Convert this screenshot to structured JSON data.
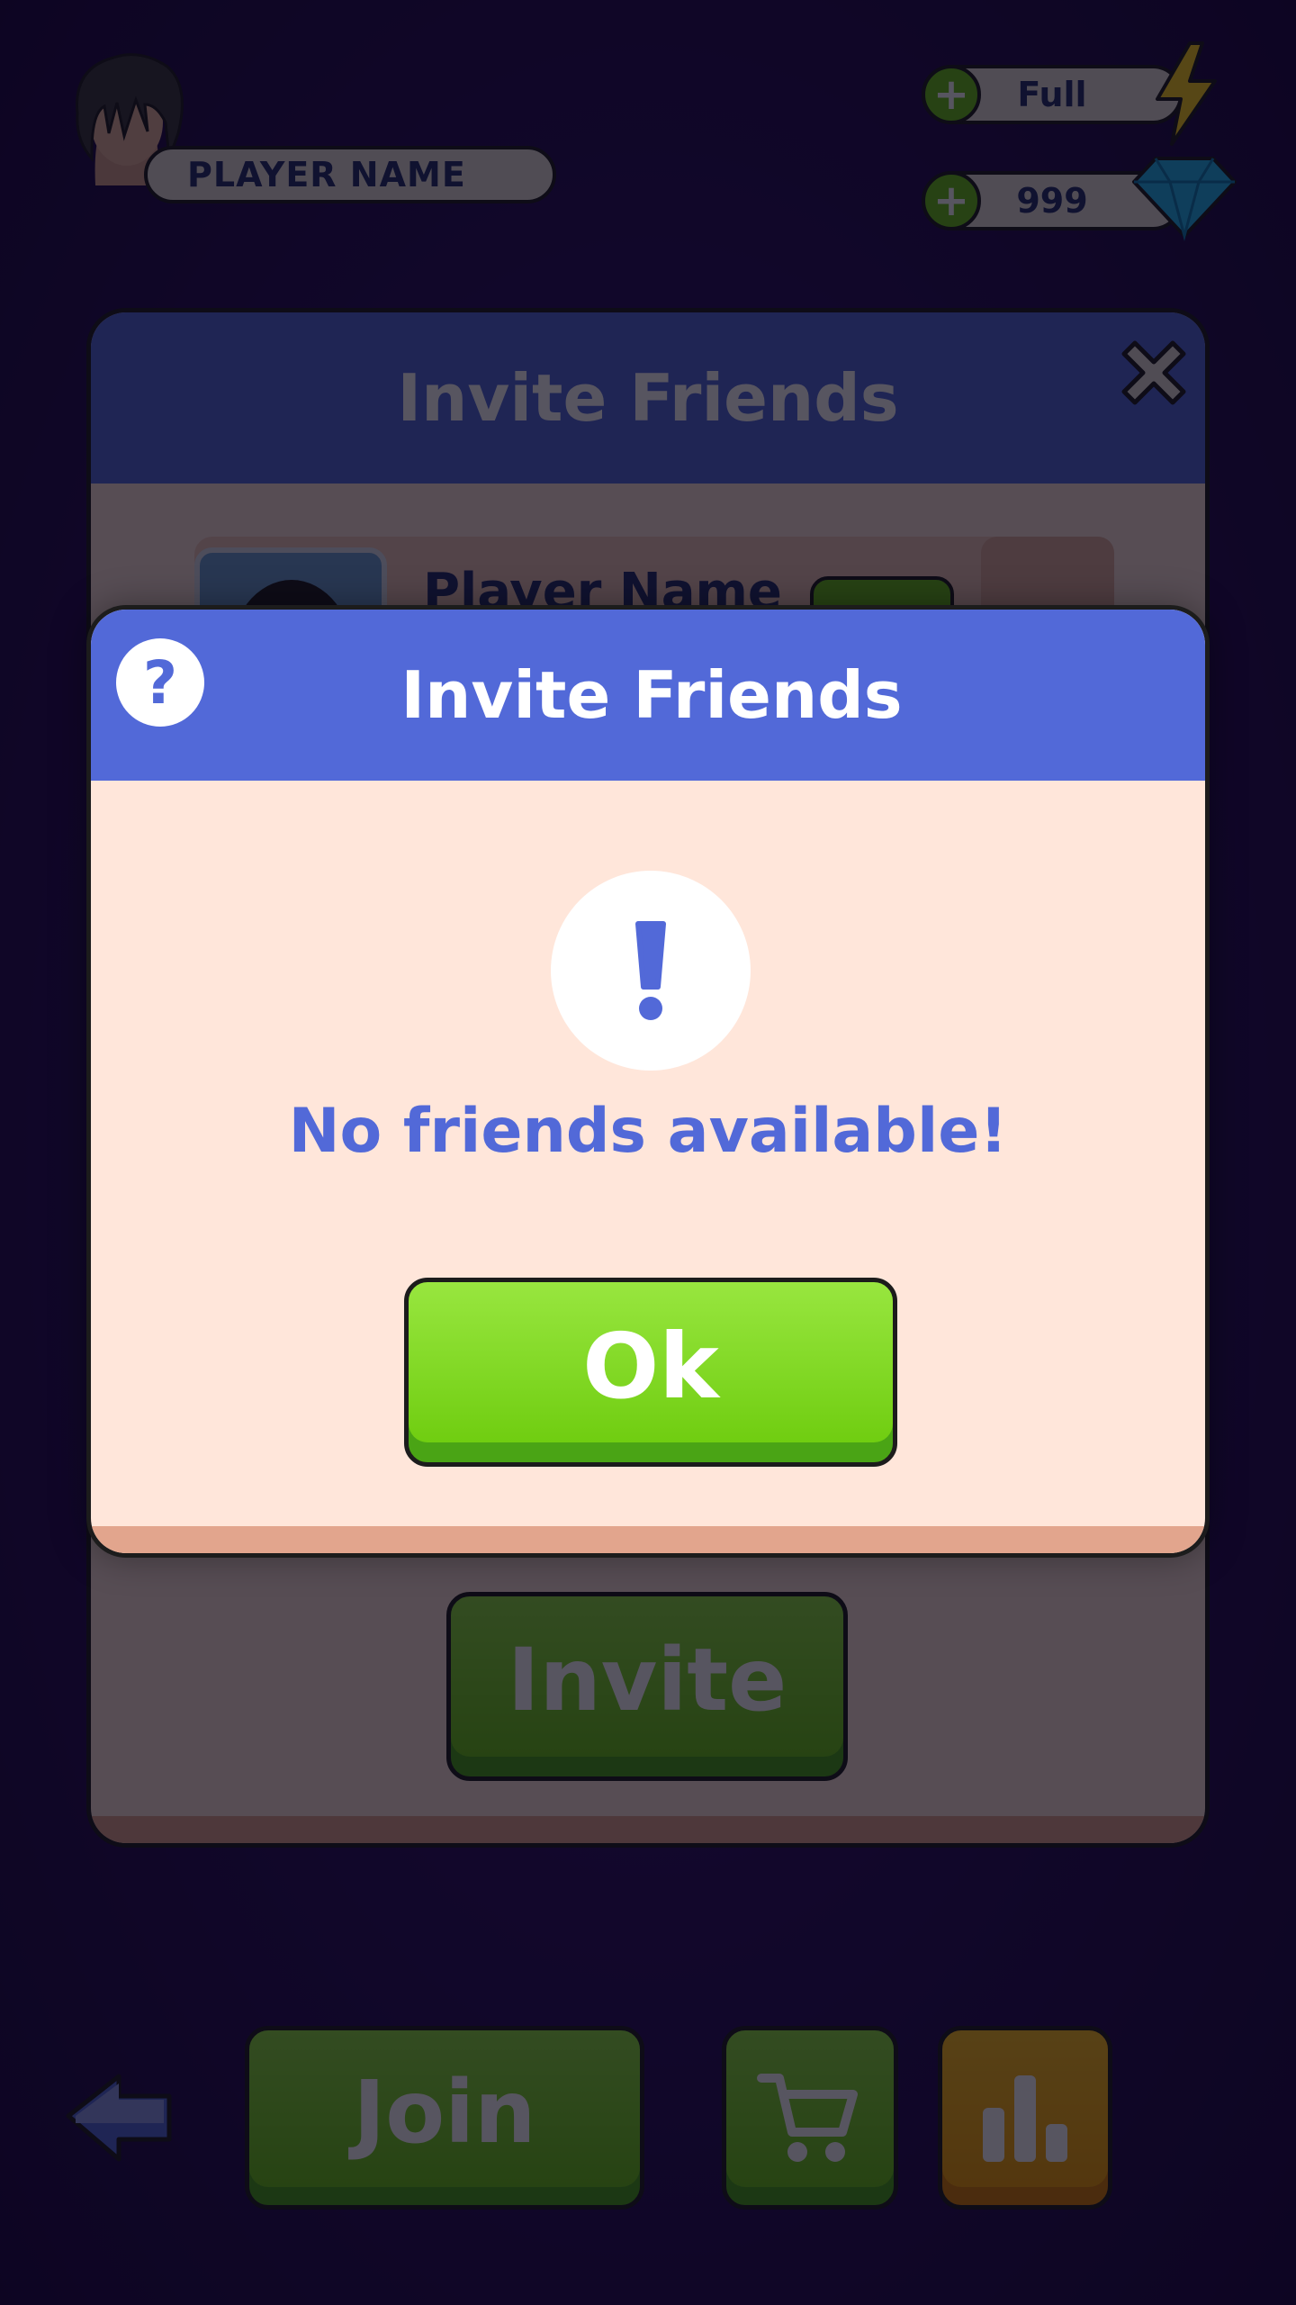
{
  "hud": {
    "player_name": "PLAYER NAME",
    "energy_value": "Full",
    "gems_value": "999",
    "plus_symbol": "+"
  },
  "panel": {
    "title": "Invite Friends",
    "row_player_name": "Player Name",
    "invite_label": "Invite"
  },
  "bottom_bar": {
    "join_label": "Join"
  },
  "modal": {
    "title": "Invite Friends",
    "help_symbol": "?",
    "message": "No friends available!",
    "ok_label": "Ok"
  },
  "colors": {
    "header_blue": "#5269d8",
    "panel_bg": "#ffe6da",
    "button_green": "#69c414",
    "button_orange": "#f39e00",
    "text_navy": "#23306b"
  },
  "icons": {
    "help": "question-icon",
    "alert": "exclamation-icon",
    "close": "close-icon",
    "energy": "lightning-icon",
    "gems": "gem-icon",
    "back": "back-arrow-icon",
    "shop": "cart-icon",
    "stats": "bar-chart-icon"
  }
}
